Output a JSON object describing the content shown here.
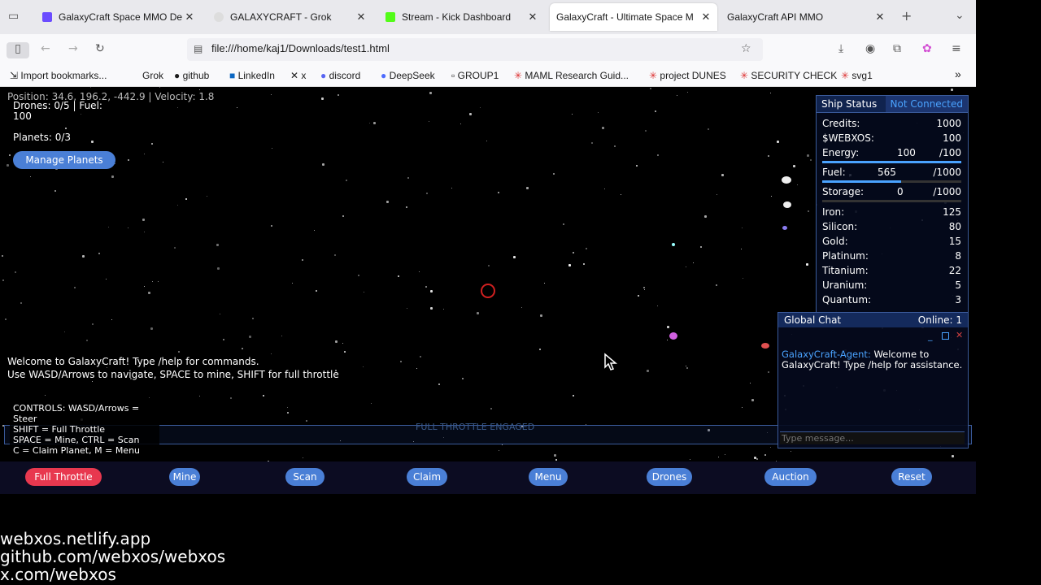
{
  "browser": {
    "tabs": [
      {
        "title": "GalaxyCraft Space MMO De",
        "fav": "#6b4cff",
        "active": false
      },
      {
        "title": "GALAXYCRAFT - Grok",
        "fav": "#eaeaea",
        "active": false
      },
      {
        "title": "Stream - Kick Dashboard",
        "fav": "#53fc18",
        "active": false
      },
      {
        "title": "GalaxyCraft - Ultimate Space M",
        "fav": "#ffffff",
        "active": true
      },
      {
        "title": "GalaxyCraft API MMO",
        "fav": "#ffffff",
        "active": false
      }
    ],
    "url": "file:///home/kaj1/Downloads/test1.html",
    "bookmarks": [
      "Import bookmarks...",
      "Grok",
      "github",
      "LinkedIn",
      "x",
      "discord",
      "DeepSeek",
      "GROUP1",
      "MAML Research Guid...",
      "project DUNES",
      "SECURITY CHECK",
      "svg1"
    ]
  },
  "hud": {
    "position": "Position: 34.6, 196.2, -442.9 | Velocity: 1.8",
    "drones": "Drones: 0/5 | Fuel: 100",
    "planets": "Planets: 0/3",
    "manage": "Manage Planets",
    "welcome1": "Welcome to GalaxyCraft! Type /help for commands.",
    "welcome2": "Use WASD/Arrows to navigate, SPACE to mine, SHIFT for full throttle",
    "controls1": "CONTROLS: WASD/Arrows = Steer",
    "controls2": "SHIFT = Full Throttle",
    "controls3": "SPACE = Mine, CTRL = Scan",
    "controls4": "C = Claim Planet, M = Menu",
    "throttle": "FULL THROTTLE ENGAGED"
  },
  "status": {
    "title": "Ship Status",
    "conn": "Not Connected",
    "credits": {
      "label": "Credits:",
      "value": "1000"
    },
    "webxos": {
      "label": "$WEBXOS:",
      "value": "100"
    },
    "energy": {
      "label": "Energy:",
      "value": "100",
      "max": "/100",
      "pct": 1.0
    },
    "fuel": {
      "label": "Fuel:",
      "value": "565",
      "max": "/1000",
      "pct": 0.565
    },
    "storage": {
      "label": "Storage:",
      "value": "0",
      "max": "/1000",
      "pct": 0.0
    },
    "resources": [
      {
        "name": "Iron:",
        "value": "125"
      },
      {
        "name": "Silicon:",
        "value": "80"
      },
      {
        "name": "Gold:",
        "value": "15"
      },
      {
        "name": "Platinum:",
        "value": "8"
      },
      {
        "name": "Titanium:",
        "value": "22"
      },
      {
        "name": "Uranium:",
        "value": "5"
      },
      {
        "name": "Quantum:",
        "value": "3"
      }
    ]
  },
  "chat": {
    "title": "Global Chat",
    "online": "Online: 1",
    "sender": "GalaxyCraft-Agent:",
    "message": "Welcome to GalaxyCraft! Type /help for assistance.",
    "placeholder": "Type message..."
  },
  "buttons": [
    "Full Throttle",
    "Mine",
    "Scan",
    "Claim",
    "Menu",
    "Drones",
    "Auction",
    "Reset"
  ],
  "footer": [
    "webxos.netlify.app",
    "github.com/webxos/webxos",
    "x.com/webxos"
  ],
  "colors": {
    "accent": "#4a7fd6",
    "danger": "#e8384f",
    "panel": "#050a1e"
  }
}
